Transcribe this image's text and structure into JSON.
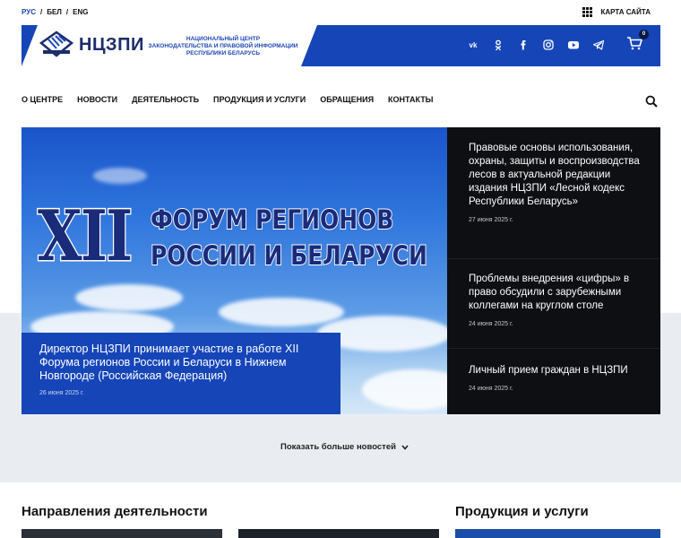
{
  "lang": {
    "items": [
      "РУС",
      "БЕЛ",
      "ENG"
    ],
    "sep": "/"
  },
  "sitemap": {
    "label": "КАРТА САЙТА",
    "icon": "grid-icon"
  },
  "logo": {
    "name": "НЦЗПИ",
    "sub": [
      "НАЦИОНАЛЬНЫЙ ЦЕНТР",
      "ЗАКОНОДАТЕЛЬСТВА И ПРАВОВОЙ ИНФОРМАЦИИ",
      "РЕСПУБЛИКИ БЕЛАРУСЬ"
    ]
  },
  "socials": [
    {
      "name": "vk-icon",
      "glyph": "vk"
    },
    {
      "name": "ok-icon",
      "glyph": "ok"
    },
    {
      "name": "facebook-icon",
      "glyph": "f"
    },
    {
      "name": "instagram-icon",
      "glyph": "ig"
    },
    {
      "name": "youtube-icon",
      "glyph": "yt"
    },
    {
      "name": "telegram-icon",
      "glyph": "tg"
    }
  ],
  "cart": {
    "count": "0"
  },
  "nav": [
    "О ЦЕНТРЕ",
    "НОВОСТИ",
    "ДЕЯТЕЛЬНОСТЬ",
    "ПРОДУКЦИЯ И УСЛУГИ",
    "ОБРАЩЕНИЯ",
    "КОНТАКТЫ"
  ],
  "hero": {
    "image_text": {
      "roman": "XII",
      "line1": "ФОРУМ РЕГИОНОВ",
      "line2": "РОССИИ И БЕЛАРУСИ"
    },
    "title": "Директор НЦЗПИ принимает участие в работе XII Форума регионов России и Беларуси в Нижнем Новгороде (Российская Федерация)",
    "date": "26 июня 2025 г."
  },
  "news": [
    {
      "title": "Правовые основы использования, охраны, защиты и воспроизводства лесов в актуальной редакции издания НЦЗПИ «Лесной кодекс Республики Беларусь»",
      "date": "27 июня 2025 г."
    },
    {
      "title": "Проблемы внедрения «цифры» в право обсудили с зарубежными коллегами на круглом столе",
      "date": "24 июня 2025 г."
    },
    {
      "title": "Личный прием граждан в НЦЗПИ",
      "date": "24 июня 2025 г."
    }
  ],
  "more_news": "Показать больше новостей",
  "sections": {
    "directions": "Направления деятельности",
    "products": "Продукция и услуги"
  },
  "colors": {
    "brand_blue": "#1645b8",
    "dark": "#0d0f12",
    "grey_band": "#e9edf1"
  }
}
